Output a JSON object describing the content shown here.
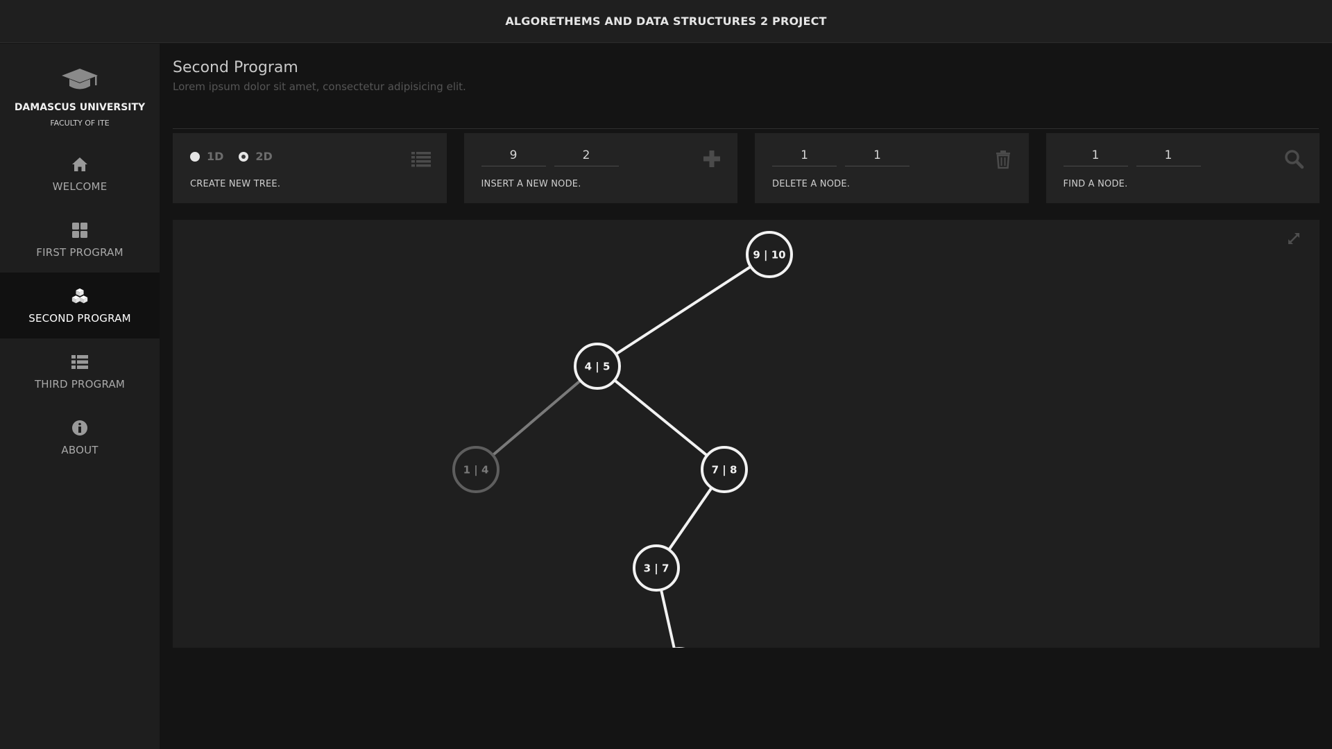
{
  "app": {
    "title": "ALGORETHEMS AND DATA STRUCTURES 2 PROJECT"
  },
  "sidebar": {
    "brand": {
      "name": "DAMASCUS UNIVERSITY",
      "subtitle": "FACULTY OF ITE",
      "icon": "graduation-cap-icon"
    },
    "items": [
      {
        "label": "WELCOME",
        "icon": "home-icon",
        "active": false
      },
      {
        "label": "FIRST PROGRAM",
        "icon": "grid-icon",
        "active": false
      },
      {
        "label": "SECOND PROGRAM",
        "icon": "cubes-icon",
        "active": true
      },
      {
        "label": "THIRD PROGRAM",
        "icon": "list-icon",
        "active": false
      },
      {
        "label": "ABOUT",
        "icon": "info-icon",
        "active": false
      }
    ]
  },
  "page": {
    "title": "Second Program",
    "subtitle": "Lorem ipsum dolor sit amet, consectetur adipisicing elit."
  },
  "controls": {
    "create": {
      "options": [
        {
          "label": "1D",
          "checked": false
        },
        {
          "label": "2D",
          "checked": true
        }
      ],
      "label": "CREATE NEW TREE.",
      "icon": "list-icon"
    },
    "insert": {
      "x": "9",
      "y": "2",
      "label": "INSERT A NEW NODE.",
      "icon": "plus-icon"
    },
    "delete": {
      "x": "1",
      "y": "1",
      "label": "DELETE A NODE.",
      "icon": "trash-icon"
    },
    "find": {
      "x": "1",
      "y": "1",
      "label": "FIND A NODE.",
      "icon": "search-icon"
    }
  },
  "tree": {
    "nodes": [
      {
        "id": "n1",
        "label": "9 | 10",
        "dimmed": false
      },
      {
        "id": "n2",
        "label": "4 | 5",
        "dimmed": false
      },
      {
        "id": "n3",
        "label": "1 | 4",
        "dimmed": true
      },
      {
        "id": "n4",
        "label": "7 | 8",
        "dimmed": false
      },
      {
        "id": "n5",
        "label": "3 | 7",
        "dimmed": false
      },
      {
        "id": "n6",
        "label": "",
        "dimmed": false
      }
    ],
    "edges": [
      {
        "from": "n1",
        "to": "n2",
        "dimmed": false
      },
      {
        "from": "n2",
        "to": "n3",
        "dimmed": true
      },
      {
        "from": "n2",
        "to": "n4",
        "dimmed": false
      },
      {
        "from": "n4",
        "to": "n5",
        "dimmed": false
      },
      {
        "from": "n5",
        "to": "n6",
        "dimmed": false
      }
    ],
    "expand_icon": "expand-icon"
  },
  "colors": {
    "background": "#141414",
    "panel": "#232323",
    "canvas": "#1f1f1f",
    "node_stroke": "#f2f2f2",
    "node_dimmed": "#5e5e5e",
    "edge_dimmed": "#7a7a7a"
  }
}
